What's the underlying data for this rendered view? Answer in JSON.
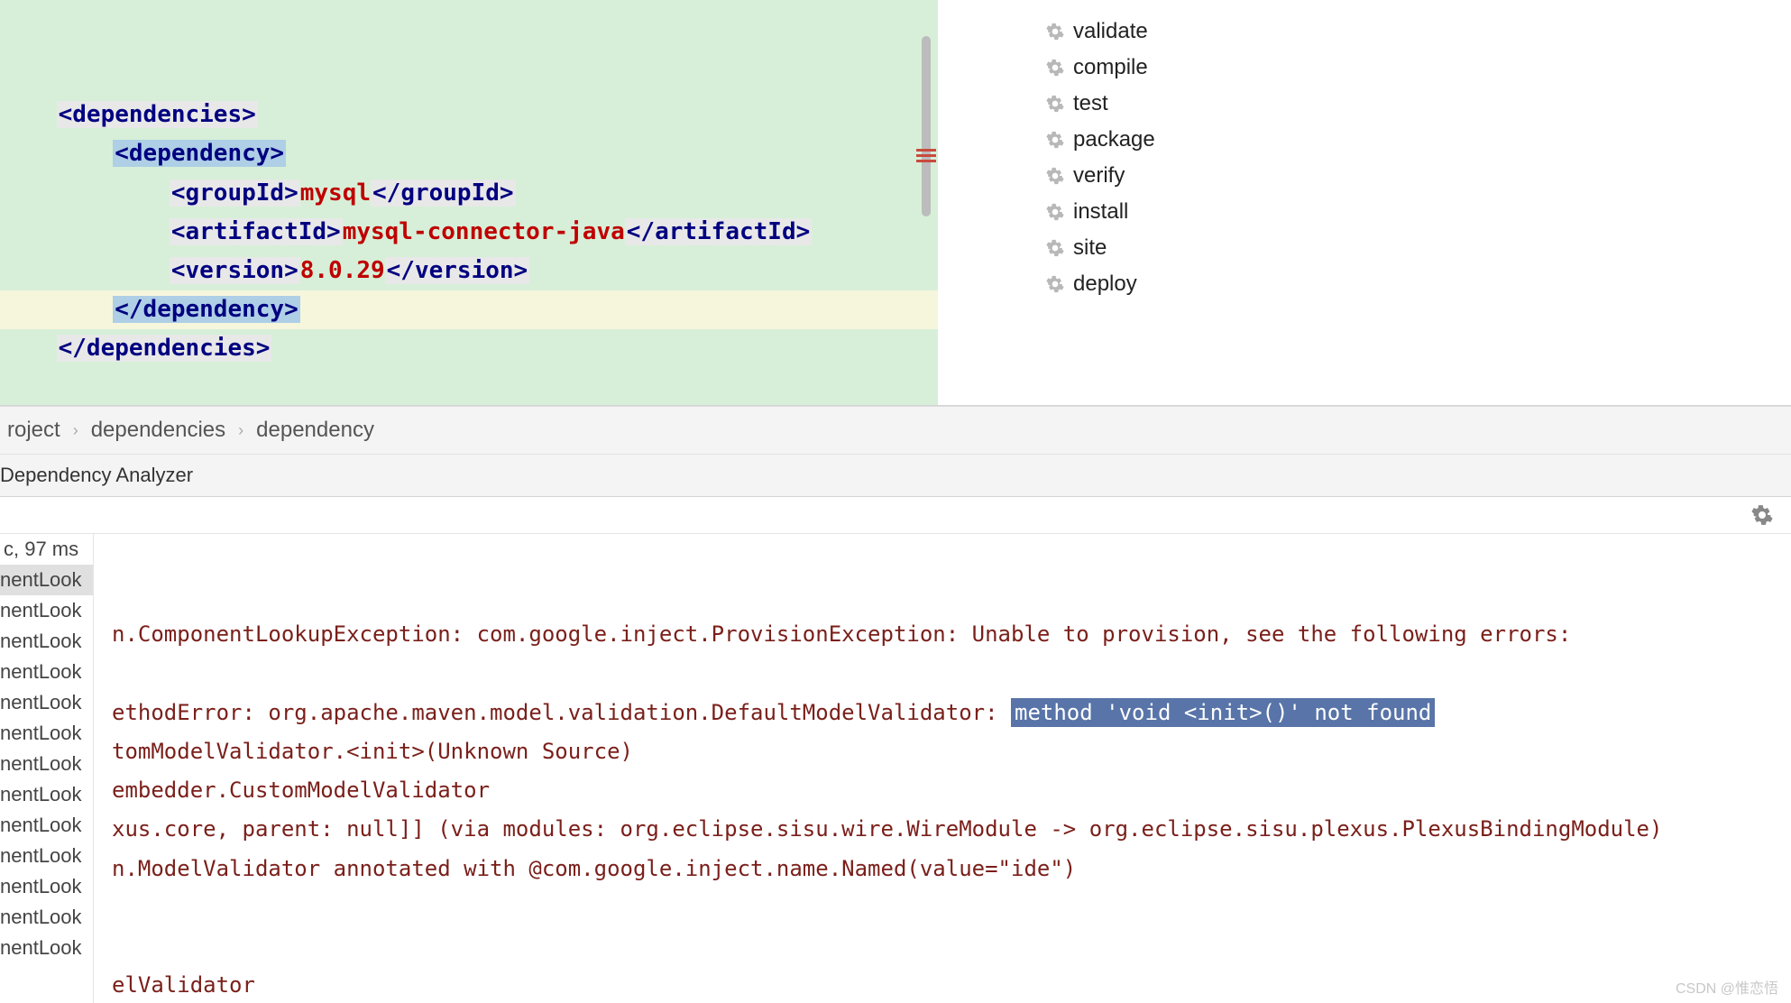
{
  "editor": {
    "lines": [
      {
        "indent": 1,
        "parts": [
          {
            "text": "<dependencies>",
            "cls": "tag-open"
          }
        ]
      },
      {
        "indent": 3,
        "parts": [
          {
            "text": "<dependency>",
            "cls": "tag-sel"
          }
        ]
      },
      {
        "indent": 5,
        "parts": [
          {
            "text": "<groupId>",
            "cls": "tag-open"
          },
          {
            "text": "mysql",
            "cls": "val-red"
          },
          {
            "text": "</groupId>",
            "cls": "tag-close"
          }
        ]
      },
      {
        "indent": 5,
        "parts": [
          {
            "text": "<artifactId>",
            "cls": "tag-open"
          },
          {
            "text": "mysql-connector-java",
            "cls": "val-red"
          },
          {
            "text": "</artifactId>",
            "cls": "tag-close"
          }
        ]
      },
      {
        "indent": 5,
        "parts": [
          {
            "text": "<version>",
            "cls": "tag-open"
          },
          {
            "text": "8.0.29",
            "cls": "val-red"
          },
          {
            "text": "</version>",
            "cls": "tag-close"
          }
        ]
      },
      {
        "indent": 3,
        "current": true,
        "parts": [
          {
            "text": "</dependency>",
            "cls": "tag-sel"
          }
        ]
      },
      {
        "indent": 1,
        "parts": [
          {
            "text": "</dependencies>",
            "cls": "tag-open"
          }
        ]
      }
    ]
  },
  "lifecycle": [
    "validate",
    "compile",
    "test",
    "package",
    "verify",
    "install",
    "site",
    "deploy"
  ],
  "breadcrumb": [
    "roject",
    "dependencies",
    "dependency"
  ],
  "tab_label": "Dependency Analyzer",
  "results": {
    "time": "c, 97 ms",
    "items": [
      "nentLook",
      "nentLook",
      "nentLook",
      "nentLook",
      "nentLook",
      "nentLook",
      "nentLook",
      "nentLook",
      "nentLook",
      "nentLook",
      "nentLook",
      "nentLook",
      "nentLook"
    ],
    "selected_index": 0
  },
  "console": {
    "lines": [
      {
        "pre": "n.ComponentLookupException: com.google.inject.ProvisionException: Unable to provision, see the following errors:",
        "sel": ""
      },
      {
        "pre": "",
        "sel": ""
      },
      {
        "pre": "ethodError: org.apache.maven.model.validation.DefaultModelValidator: ",
        "sel": "method 'void <init>()' not found"
      },
      {
        "pre": "tomModelValidator.<init>(Unknown Source)",
        "sel": ""
      },
      {
        "pre": "embedder.CustomModelValidator",
        "sel": ""
      },
      {
        "pre": "xus.core, parent: null]] (via modules: org.eclipse.sisu.wire.WireModule -> org.eclipse.sisu.plexus.PlexusBindingModule)",
        "sel": ""
      },
      {
        "pre": "n.ModelValidator annotated with @com.google.inject.name.Named(value=\"ide\")",
        "sel": ""
      },
      {
        "pre": "",
        "sel": ""
      },
      {
        "pre": "",
        "sel": ""
      },
      {
        "pre": "elValidator",
        "sel": ""
      }
    ]
  },
  "watermark": "CSDN @惟恋悟"
}
